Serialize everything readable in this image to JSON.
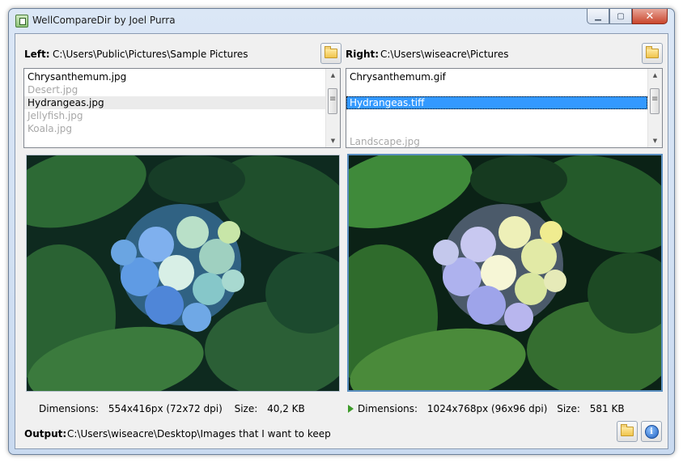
{
  "window": {
    "title": "WellCompareDir by Joel Purra"
  },
  "left": {
    "label": "Left:",
    "path": "C:\\Users\\Public\\Pictures\\Sample Pictures",
    "files": [
      {
        "name": "Chrysanthemum.jpg",
        "state": "normal"
      },
      {
        "name": "Desert.jpg",
        "state": "dim"
      },
      {
        "name": "Hydrangeas.jpg",
        "state": "highlight"
      },
      {
        "name": "Jellyfish.jpg",
        "state": "dim"
      },
      {
        "name": "Koala.jpg",
        "state": "dim"
      }
    ],
    "info": {
      "dimensions_label": "Dimensions:",
      "dimensions_value": "554x416px (72x72 dpi)",
      "size_label": "Size:",
      "size_value": "40,2 KB"
    }
  },
  "right": {
    "label": "Right:",
    "path": "C:\\Users\\wiseacre\\Pictures",
    "files": [
      {
        "name": "Chrysanthemum.gif",
        "state": "normal"
      },
      {
        "name": "",
        "state": "blank"
      },
      {
        "name": "Hydrangeas.tiff",
        "state": "selected"
      },
      {
        "name": "",
        "state": "blank"
      },
      {
        "name": "",
        "state": "blank"
      },
      {
        "name": "Landscape.jpg",
        "state": "dim"
      }
    ],
    "info": {
      "dimensions_label": "Dimensions:",
      "dimensions_value": "1024x768px (96x96 dpi)",
      "size_label": "Size:",
      "size_value": "581 KB"
    }
  },
  "output": {
    "label": "Output:",
    "path": "C:\\Users\\wiseacre\\Desktop\\Images that I want to keep"
  },
  "icons": {
    "folder": "folder-icon",
    "info": "info-icon",
    "arrow": "arrow-right-icon",
    "minimize": "minimize-icon",
    "maximize": "maximize-icon",
    "close": "close-icon"
  },
  "colors": {
    "selection": "#3399ff",
    "dim_text": "#a8a8a8",
    "arrow_green": "#3d9b2a"
  }
}
